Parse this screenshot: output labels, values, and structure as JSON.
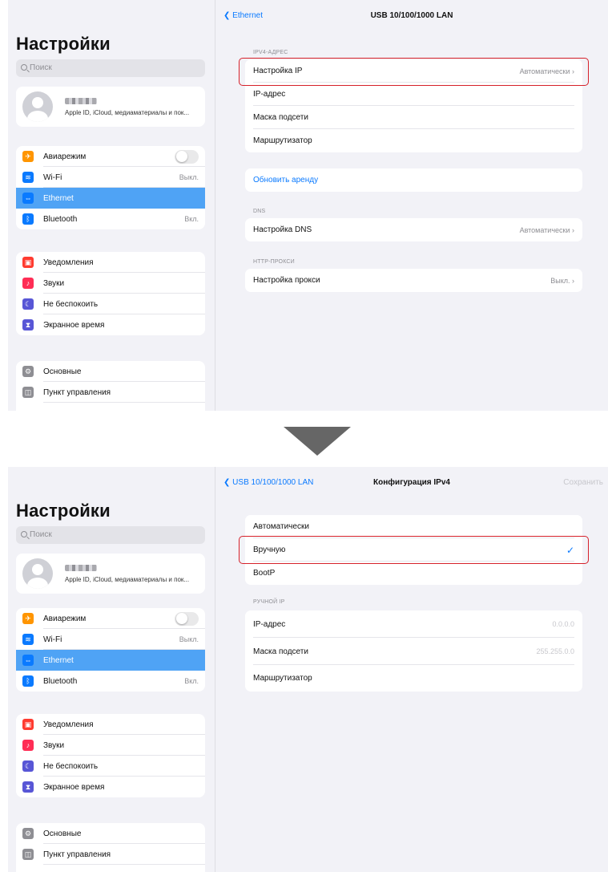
{
  "sidebar": {
    "title": "Настройки",
    "search_placeholder": "Поиск",
    "profile_subtitle": "Apple ID, iCloud, медиаматериалы и пок...",
    "group1": [
      {
        "label": "Авиарежим",
        "icon": "airplane-icon",
        "color": "#ff9500"
      },
      {
        "label": "Wi-Fi",
        "value": "Выкл.",
        "icon": "wifi-icon",
        "color": "#0a7aff"
      },
      {
        "label": "Ethernet",
        "icon": "ethernet-icon",
        "color": "#0a7aff",
        "selected": true
      },
      {
        "label": "Bluetooth",
        "value": "Вкл.",
        "icon": "bluetooth-icon",
        "color": "#0a7aff"
      }
    ],
    "group2": [
      {
        "label": "Уведомления",
        "icon": "notifications-icon",
        "color": "#ff3b30"
      },
      {
        "label": "Звуки",
        "icon": "sounds-icon",
        "color": "#ff2d55"
      },
      {
        "label": "Не беспокоить",
        "icon": "moon-icon",
        "color": "#5856d6"
      },
      {
        "label": "Экранное время",
        "icon": "hourglass-icon",
        "color": "#5856d6"
      }
    ],
    "group3": [
      {
        "label": "Основные",
        "icon": "gear-icon",
        "color": "#8e8e93"
      },
      {
        "label": "Пункт управления",
        "icon": "control-center-icon",
        "color": "#8e8e93"
      }
    ]
  },
  "screen1": {
    "back_label": "Ethernet",
    "title": "USB 10/100/1000 LAN",
    "ipv4_header": "IPV4-АДРЕС",
    "ipv4_rows": [
      {
        "label": "Настройка IP",
        "value": "Автоматически"
      },
      {
        "label": "IP-адрес",
        "value": ""
      },
      {
        "label": "Маска подсети",
        "value": ""
      },
      {
        "label": "Маршрутизатор",
        "value": ""
      }
    ],
    "renew_label": "Обновить аренду",
    "dns_header": "DNS",
    "dns_label": "Настройка DNS",
    "dns_value": "Автоматически",
    "proxy_header": "HTTP-ПРОКСИ",
    "proxy_label": "Настройка прокси",
    "proxy_value": "Выкл."
  },
  "screen2": {
    "back_label": "USB 10/100/1000 LAN",
    "title": "Конфигурация IPv4",
    "save_label": "Сохранить",
    "options": [
      "Автоматически",
      "Вручную",
      "BootP"
    ],
    "selected_option": "Вручную",
    "manual_header": "РУЧНОЙ IP",
    "manual_rows": [
      {
        "label": "IP-адрес",
        "placeholder": "0.0.0.0"
      },
      {
        "label": "Маска подсети",
        "placeholder": "255.255.0.0"
      },
      {
        "label": "Маршрутизатор",
        "placeholder": ""
      }
    ]
  },
  "colors": {
    "accent": "#0a7aff",
    "highlight": "#d6212a",
    "selected_row": "#4fa3f5"
  }
}
